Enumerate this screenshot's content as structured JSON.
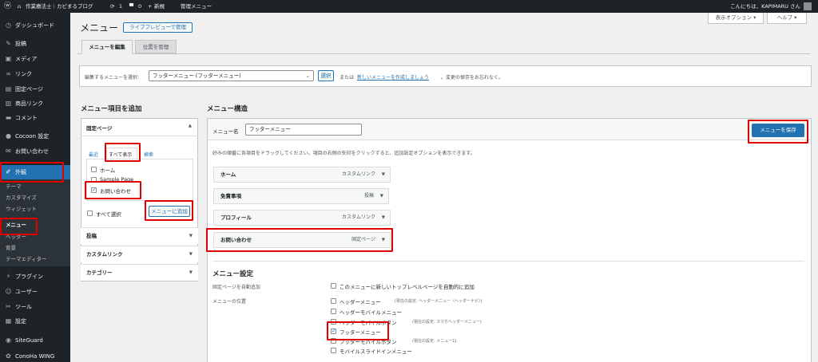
{
  "adminbar": {
    "site_name": "作業療法士｜カピまるブログ",
    "updates_count": "1",
    "comments_count": "0",
    "new_label": "新規",
    "menu_admin": "管理メニュー",
    "greeting": "こんにちは、KAPIMARU さん"
  },
  "sidebar": {
    "items": [
      {
        "label": "ダッシュボード",
        "icon": "dashboard-icon",
        "glyph": "◷"
      },
      {
        "label": "投稿",
        "icon": "pin-icon",
        "glyph": "✎"
      },
      {
        "label": "メディア",
        "icon": "media-icon",
        "glyph": "▣"
      },
      {
        "label": "リンク",
        "icon": "link-icon",
        "glyph": "∞"
      },
      {
        "label": "固定ページ",
        "icon": "page-icon",
        "glyph": "▤"
      },
      {
        "label": "商品リンク",
        "icon": "product-link-icon",
        "glyph": "▥"
      },
      {
        "label": "コメント",
        "icon": "comment-icon",
        "glyph": "▬"
      },
      {
        "label": "Cocoon 設定",
        "icon": "cocoon-icon",
        "glyph": "●"
      },
      {
        "label": "お問い合わせ",
        "icon": "mail-icon",
        "glyph": "✉"
      },
      {
        "label": "外観",
        "icon": "appearance-icon",
        "glyph": "✐"
      },
      {
        "label": "プラグイン",
        "icon": "plugin-icon",
        "glyph": "⚡"
      },
      {
        "label": "ユーザー",
        "icon": "user-icon",
        "glyph": "☺"
      },
      {
        "label": "ツール",
        "icon": "tool-icon",
        "glyph": "✂"
      },
      {
        "label": "設定",
        "icon": "settings-icon",
        "glyph": "▦"
      },
      {
        "label": "SiteGuard",
        "icon": "siteguard-icon",
        "glyph": "◉"
      },
      {
        "label": "ConoHa WING",
        "icon": "conoha-icon",
        "glyph": "✿"
      }
    ],
    "submenu": [
      "テーマ",
      "カスタマイズ",
      "ウィジェット",
      "メニュー",
      "ヘッダー",
      "背景",
      "テーマエディター"
    ]
  },
  "topbuttons": {
    "screen_options": "表示オプション ▾",
    "help": "ヘルプ ▾"
  },
  "header": {
    "title": "メニュー",
    "live_preview": "ライブプレビューで管理"
  },
  "tabs": {
    "edit": "メニューを編集",
    "locations": "位置を管理"
  },
  "select_bar": {
    "label": "編集するメニューを選択:",
    "selected": "フッターメニュー (フッターメニュー)",
    "select_button": "選択",
    "or": "または",
    "create_link": "新しいメニューを作成しましょう",
    "suffix": "。変更の保存をお忘れなく。"
  },
  "add_items": {
    "heading": "メニュー項目を追加",
    "pages_title": "固定ページ",
    "tab_recent": "最近",
    "tab_all": "すべて表示",
    "tab_search": "検索",
    "pages": [
      {
        "label": "ホーム",
        "checked": false
      },
      {
        "label": "Sample Page",
        "checked": false
      },
      {
        "label": "お問い合わせ",
        "checked": true
      }
    ],
    "select_all": "すべて選択",
    "add_button": "メニューに追加",
    "sections": [
      "投稿",
      "カスタムリンク",
      "カテゴリー"
    ]
  },
  "structure": {
    "heading": "メニュー構造",
    "name_label": "メニュー名",
    "name_value": "フッターメニュー",
    "save_button": "メニューを保存",
    "instructions": "好みの順番に各項目をドラッグしてください。項目の右側の矢印をクリックすると、追加設定オプションを表示できます。",
    "items": [
      {
        "title": "ホーム",
        "type": "カスタムリンク"
      },
      {
        "title": "免責事項",
        "type": "投稿"
      },
      {
        "title": "プロフィール",
        "type": "カスタムリンク"
      },
      {
        "title": "お問い合わせ",
        "type": "固定ページ"
      }
    ]
  },
  "settings": {
    "heading": "メニュー設定",
    "auto_add_label": "固定ページを自動追加",
    "auto_add_option": "このメニューに新しいトップレベルページを自動的に追加",
    "location_label": "メニューの位置",
    "locations": [
      {
        "name": "ヘッダーメニュー",
        "note": "(現在の設定: ヘッダーメニュー（ヘッダーナビ）)",
        "checked": false
      },
      {
        "name": "ヘッダーモバイルメニュー",
        "note": "",
        "checked": false
      },
      {
        "name": "ヘッダーモバイルボタン",
        "note": "(現在の設定: スマホヘッダーメニュー)",
        "checked": false
      },
      {
        "name": "フッターメニュー",
        "note": "",
        "checked": true
      },
      {
        "name": "フッターモバイルボタン",
        "note": "(現在の設定: メニュー1)",
        "checked": false
      },
      {
        "name": "モバイルスライドインメニュー",
        "note": "",
        "checked": false
      }
    ]
  },
  "colors": {
    "accent": "#2271b1",
    "highlight": "#e00000",
    "adminbar": "#1d2327"
  }
}
